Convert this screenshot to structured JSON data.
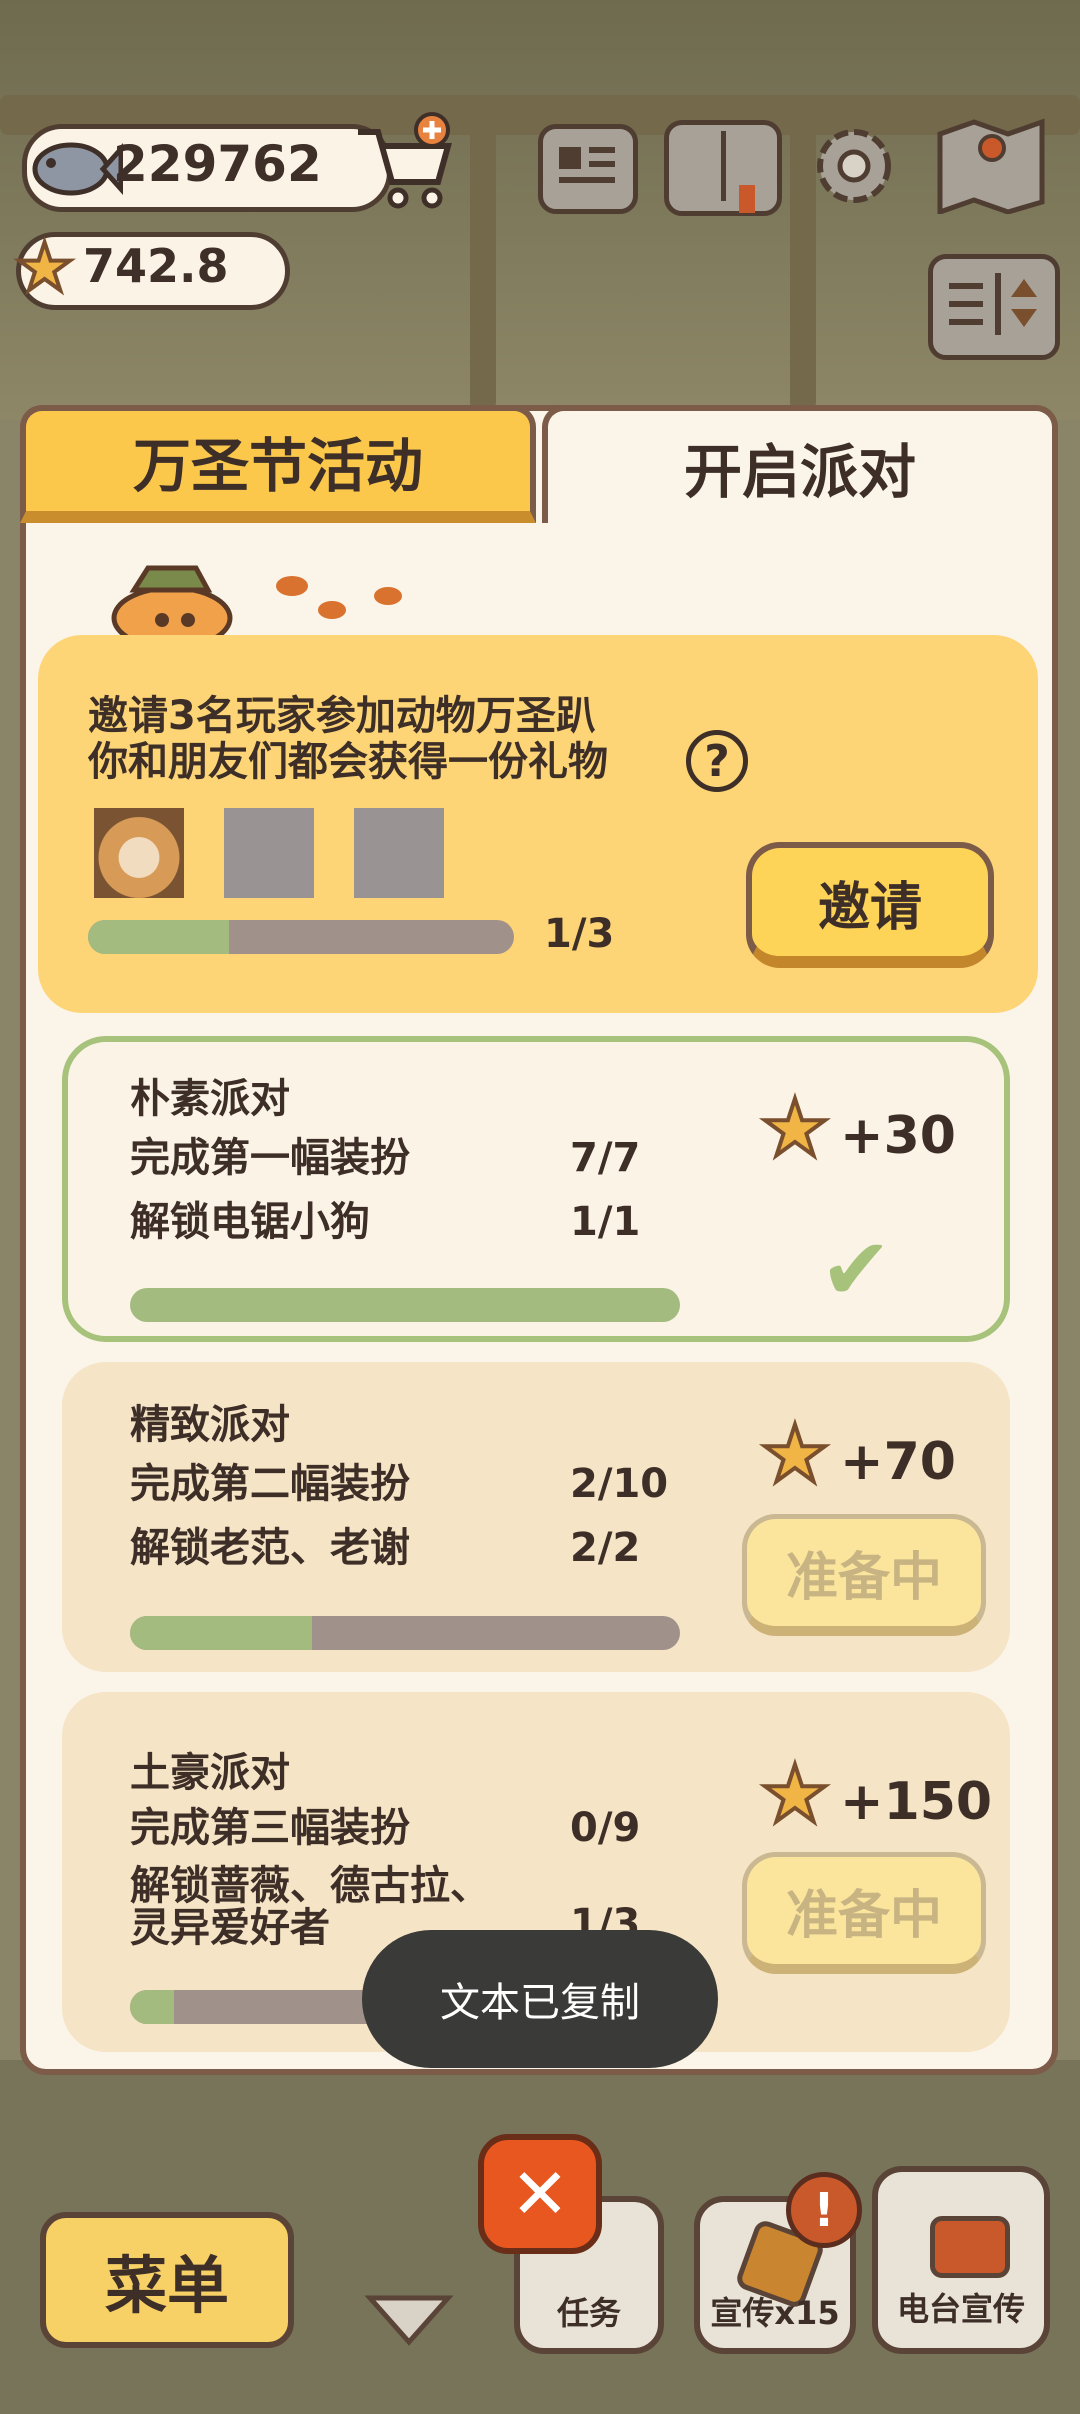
{
  "currency": {
    "fish": "229762",
    "stars": "742.8"
  },
  "tabs": {
    "halloween": "万圣节活动",
    "party": "开启派对"
  },
  "invite": {
    "line1": "邀请3名玩家参加动物万圣趴",
    "line2": "你和朋友们都会获得一份礼物",
    "help": "?",
    "progress_text": "1/3",
    "progress": 0.33,
    "button": "邀请"
  },
  "tasks": [
    {
      "title": "朴素派对",
      "req1": "完成第一幅装扮",
      "req1_count": "7/7",
      "req2": "解锁电锯小狗",
      "req2_count": "1/1",
      "reward": "+30",
      "progress": 1.0,
      "status": "completed"
    },
    {
      "title": "精致派对",
      "req1": "完成第二幅装扮",
      "req1_count": "2/10",
      "req2": "解锁老范、老谢",
      "req2_count": "2/2",
      "reward": "+70",
      "progress": 0.33,
      "button": "准备中"
    },
    {
      "title": "土豪派对",
      "req1": "完成第三幅装扮",
      "req1_count": "0/9",
      "req2a": "解锁蔷薇、德古拉、",
      "req2b": "灵异爱好者",
      "req2_count": "1/3",
      "reward": "+150",
      "progress": 0.08,
      "button": "准备中"
    }
  ],
  "toast": "文本已复制",
  "bottom": {
    "menu": "菜单",
    "tasks": "任务",
    "promo": "宣传x15",
    "radio": "电台宣传",
    "alert": "!"
  },
  "close_symbol": "✕",
  "icons": [
    "fish-icon",
    "cart-icon",
    "star-icon",
    "news-icon",
    "book-icon",
    "gear-icon",
    "map-icon",
    "toggle-icon",
    "question-icon",
    "check-icon",
    "close-icon",
    "chevron-down-icon",
    "radio-icon"
  ],
  "colors": {
    "accent": "#fdd358",
    "done": "#a7c27b",
    "panel": "#fbf4e8",
    "border": "#7c5b48"
  }
}
